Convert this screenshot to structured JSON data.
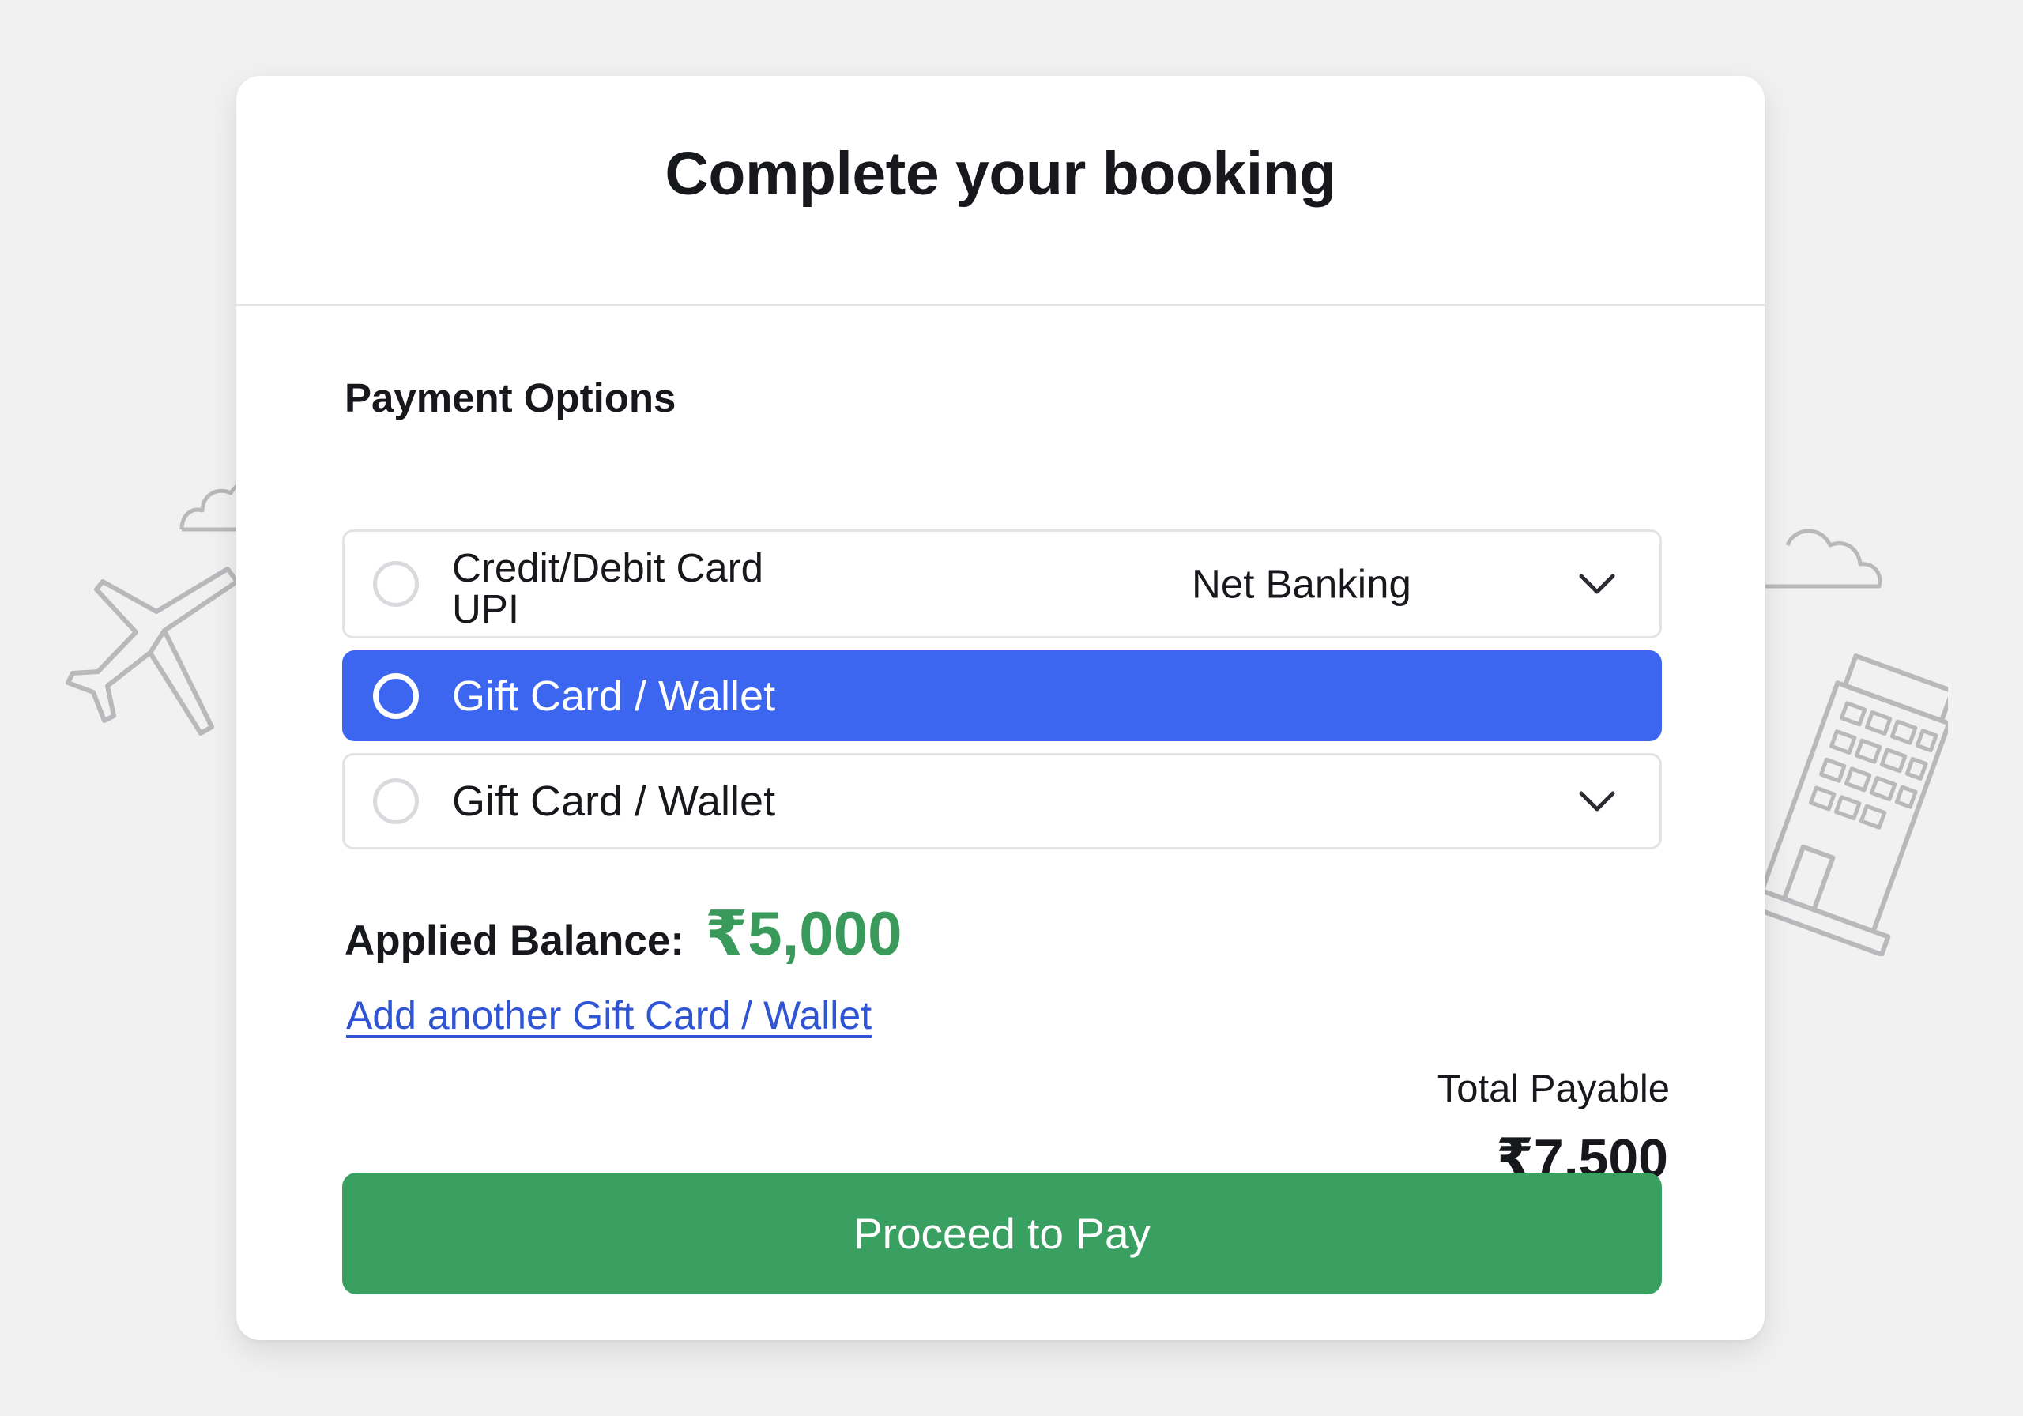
{
  "header": {
    "title": "Complete your booking"
  },
  "payment": {
    "section_label": "Payment Options",
    "options": [
      {
        "line1": "Credit/Debit Card",
        "line2": "UPI",
        "side_label": "Net Banking",
        "selected": false
      },
      {
        "label": "Gift Card / Wallet",
        "selected": true
      },
      {
        "label": "Gift Card / Wallet",
        "selected": false
      }
    ]
  },
  "balance": {
    "label": "Applied Balance:",
    "amount": "₹5,000"
  },
  "add_link": "Add another Gift Card / Wallet",
  "total": {
    "label": "Total Payable",
    "amount": "₹7,500"
  },
  "cta": {
    "label": "Proceed to Pay"
  },
  "colors": {
    "accent_blue": "#3c66ef",
    "success_green": "#3aa062",
    "balance_green": "#3a9a5c",
    "link_blue": "#2f55d4"
  },
  "icons": [
    "airplane-icon",
    "cloud-icon",
    "hotel-building-icon",
    "chevron-down-icon",
    "radio-button"
  ]
}
